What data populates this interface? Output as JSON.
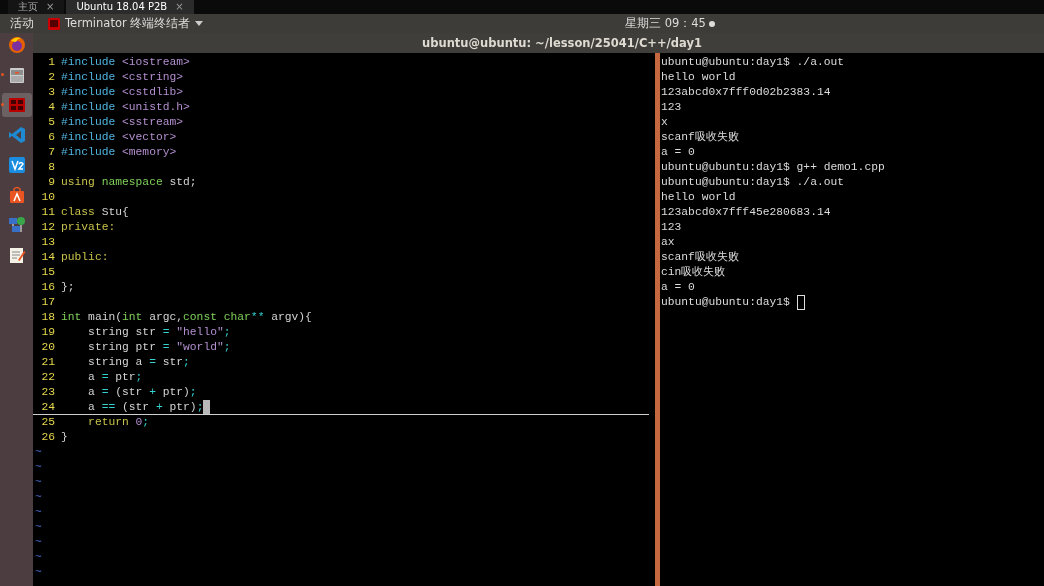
{
  "browser_tabs": [
    {
      "label": "主页",
      "close": "×",
      "selected": false
    },
    {
      "label": "Ubuntu 18.04 P2B",
      "close": "×",
      "selected": true
    }
  ],
  "top_bar": {
    "activities": "活动",
    "app_menu": "Terminator 终端终结者",
    "clock": "星期三 09：45"
  },
  "dock": [
    {
      "kind": "firefox",
      "running": false,
      "active": false
    },
    {
      "kind": "files",
      "running": true,
      "active": false
    },
    {
      "kind": "terminator",
      "running": true,
      "active": true
    },
    {
      "kind": "vscode",
      "running": false,
      "active": false
    },
    {
      "kind": "vnc",
      "running": false,
      "active": false
    },
    {
      "kind": "store",
      "running": false,
      "active": false
    },
    {
      "kind": "network",
      "running": false,
      "active": false
    },
    {
      "kind": "editor",
      "running": false,
      "active": false
    }
  ],
  "window": {
    "title": "ubuntu@ubuntu: ~/lesson/25041/C++/day1"
  },
  "editor": {
    "lines": [
      {
        "number": "1",
        "cursor": false,
        "tokens": [
          {
            "kind": "pre",
            "text": "#include"
          },
          {
            "kind": "inc",
            "text": " <iostream>"
          }
        ]
      },
      {
        "number": "2",
        "cursor": false,
        "tokens": [
          {
            "kind": "pre",
            "text": "#include"
          },
          {
            "kind": "inc",
            "text": " <cstring>"
          }
        ]
      },
      {
        "number": "3",
        "cursor": false,
        "tokens": [
          {
            "kind": "pre",
            "text": "#include"
          },
          {
            "kind": "inc",
            "text": " <cstdlib>"
          }
        ]
      },
      {
        "number": "4",
        "cursor": false,
        "tokens": [
          {
            "kind": "pre",
            "text": "#include"
          },
          {
            "kind": "inc",
            "text": " <unistd.h>"
          }
        ]
      },
      {
        "number": "5",
        "cursor": false,
        "tokens": [
          {
            "kind": "pre",
            "text": "#include"
          },
          {
            "kind": "inc",
            "text": " <sstream>"
          }
        ]
      },
      {
        "number": "6",
        "cursor": false,
        "tokens": [
          {
            "kind": "pre",
            "text": "#include"
          },
          {
            "kind": "inc",
            "text": " <vector>"
          }
        ]
      },
      {
        "number": "7",
        "cursor": false,
        "tokens": [
          {
            "kind": "pre",
            "text": "#include"
          },
          {
            "kind": "inc",
            "text": " <memory>"
          }
        ]
      },
      {
        "number": "8",
        "cursor": false
      },
      {
        "number": "9",
        "cursor": false,
        "tokens": [
          {
            "kind": "stmt",
            "text": "using"
          },
          {
            "kind": "type",
            "text": " namespace"
          },
          {
            "kind": "plain",
            "text": " std;"
          }
        ]
      },
      {
        "number": "10",
        "cursor": false
      },
      {
        "number": "11",
        "cursor": false,
        "tokens": [
          {
            "kind": "stmt",
            "text": "class"
          },
          {
            "kind": "plain",
            "text": " Stu{"
          }
        ]
      },
      {
        "number": "12",
        "cursor": false,
        "tokens": [
          {
            "kind": "stmt",
            "text": "private:"
          }
        ]
      },
      {
        "number": "13",
        "cursor": false
      },
      {
        "number": "14",
        "cursor": false,
        "tokens": [
          {
            "kind": "stmt",
            "text": "public:"
          }
        ]
      },
      {
        "number": "15",
        "cursor": false
      },
      {
        "number": "16",
        "cursor": false,
        "tokens": [
          {
            "kind": "plain",
            "text": "};"
          }
        ]
      },
      {
        "number": "17",
        "cursor": false
      },
      {
        "number": "18",
        "cursor": false,
        "tokens": [
          {
            "kind": "type",
            "text": "int"
          },
          {
            "kind": "plain",
            "text": " main("
          },
          {
            "kind": "type",
            "text": "int"
          },
          {
            "kind": "plain",
            "text": " argc,"
          },
          {
            "kind": "type",
            "text": "const char"
          },
          {
            "kind": "op",
            "text": "**"
          },
          {
            "kind": "plain",
            "text": " argv){"
          }
        ]
      },
      {
        "number": "19",
        "cursor": false,
        "tokens": [
          {
            "kind": "plain",
            "text": "    string str "
          },
          {
            "kind": "op",
            "text": "="
          },
          {
            "kind": "str",
            "text": " \"hello\""
          },
          {
            "kind": "op",
            "text": ";"
          }
        ]
      },
      {
        "number": "20",
        "cursor": false,
        "tokens": [
          {
            "kind": "plain",
            "text": "    string ptr "
          },
          {
            "kind": "op",
            "text": "="
          },
          {
            "kind": "str",
            "text": " \"world\""
          },
          {
            "kind": "op",
            "text": ";"
          }
        ]
      },
      {
        "number": "21",
        "cursor": false,
        "tokens": [
          {
            "kind": "plain",
            "text": "    string a "
          },
          {
            "kind": "op",
            "text": "="
          },
          {
            "kind": "plain",
            "text": " str"
          },
          {
            "kind": "op",
            "text": ";"
          }
        ]
      },
      {
        "number": "22",
        "cursor": false,
        "tokens": [
          {
            "kind": "plain",
            "text": "    a "
          },
          {
            "kind": "op",
            "text": "="
          },
          {
            "kind": "plain",
            "text": " ptr"
          },
          {
            "kind": "op",
            "text": ";"
          }
        ]
      },
      {
        "number": "23",
        "cursor": false,
        "tokens": [
          {
            "kind": "plain",
            "text": "    a "
          },
          {
            "kind": "op",
            "text": "="
          },
          {
            "kind": "plain",
            "text": " (str "
          },
          {
            "kind": "op",
            "text": "+"
          },
          {
            "kind": "plain",
            "text": " ptr)"
          },
          {
            "kind": "op",
            "text": ";"
          }
        ]
      },
      {
        "number": "24",
        "cursor": true,
        "tokens": [
          {
            "kind": "plain",
            "text": "    a "
          },
          {
            "kind": "op",
            "text": "=="
          },
          {
            "kind": "plain",
            "text": " (str "
          },
          {
            "kind": "op",
            "text": "+"
          },
          {
            "kind": "plain",
            "text": " ptr)"
          },
          {
            "kind": "op",
            "text": ";"
          }
        ]
      },
      {
        "number": "25",
        "cursor": false,
        "tokens": [
          {
            "kind": "stmt",
            "text": "    return"
          },
          {
            "kind": "str",
            "text": " 0"
          },
          {
            "kind": "op",
            "text": ";"
          }
        ]
      },
      {
        "number": "26",
        "cursor": false,
        "tokens": [
          {
            "kind": "plain",
            "text": "}"
          }
        ]
      }
    ],
    "filler": [
      "~",
      "~",
      "~",
      "~",
      "~",
      "~",
      "~",
      "~",
      "~"
    ]
  },
  "terminal": {
    "cursor": true,
    "lines": [
      "ubuntu@ubuntu:day1$ ./a.out",
      "hello world",
      "123abcd0x7fff0d02b2383.14",
      "123",
      "x",
      "scanf吸收失败",
      "a = 0",
      "ubuntu@ubuntu:day1$ g++ demo1.cpp",
      "ubuntu@ubuntu:day1$ ./a.out",
      "hello world",
      "123abcd0x7fff45e280683.14",
      "123",
      "ax",
      "scanf吸收失败",
      "cin吸收失败",
      "a = 0",
      "ubuntu@ubuntu:day1$ "
    ]
  }
}
